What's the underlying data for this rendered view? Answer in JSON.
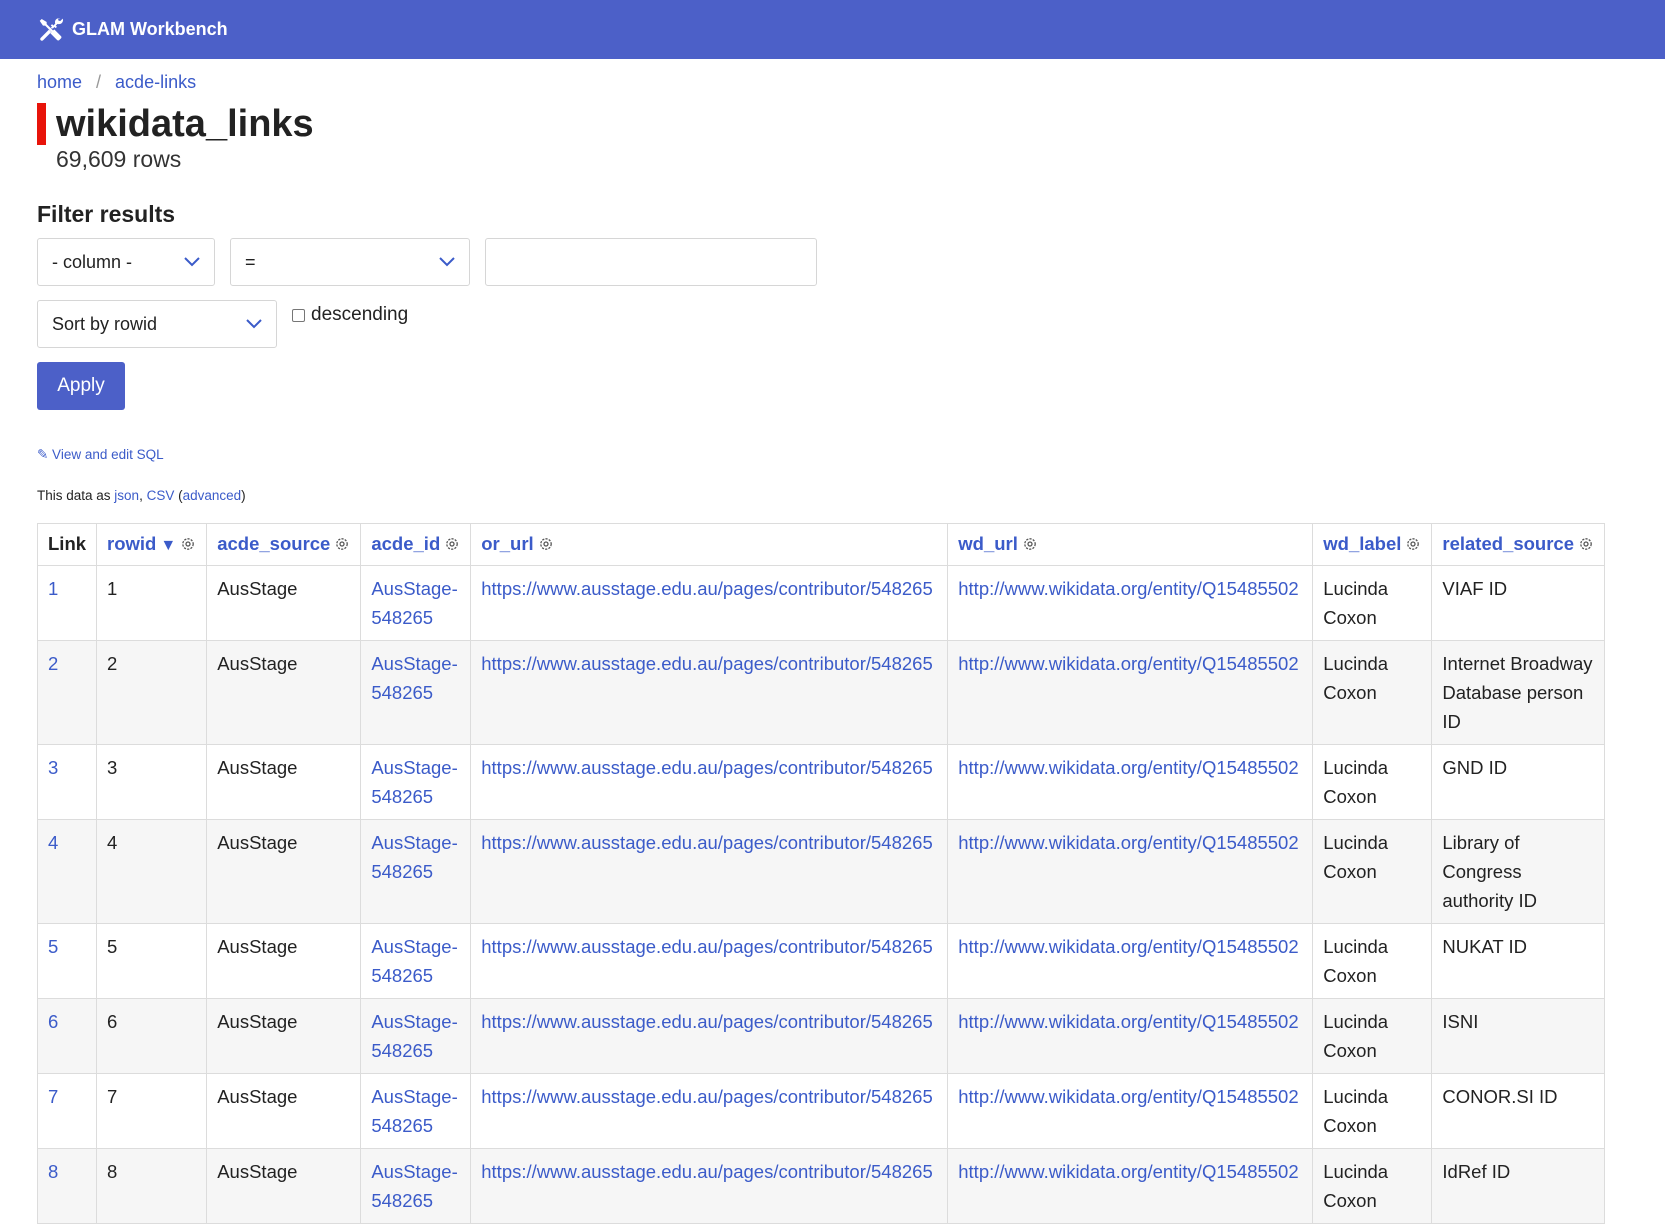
{
  "header": {
    "app_title": "GLAM Workbench",
    "icon": "tools-icon"
  },
  "breadcrumb": {
    "home": "home",
    "separator": "/",
    "db": "acde-links"
  },
  "page": {
    "title": "wikidata_links",
    "row_count": "69,609 rows"
  },
  "filter": {
    "heading": "Filter results",
    "column_select": "- column -",
    "op_select": "=",
    "value": "",
    "sort_select": "Sort by rowid",
    "descending_label": "descending",
    "descending_checked": false,
    "apply_label": "Apply"
  },
  "links": {
    "view_sql": "✎ View and edit SQL",
    "data_as_prefix": "This data as ",
    "json": "json",
    "comma": ", ",
    "csv": "CSV",
    "paren_open": " (",
    "advanced": "advanced",
    "paren_close": ")"
  },
  "table": {
    "columns": [
      "Link",
      "rowid",
      "acde_source",
      "acde_id",
      "or_url",
      "wd_url",
      "wd_label",
      "related_source"
    ],
    "sort_indicator": "▼",
    "rows": [
      {
        "link": "1",
        "rowid": "1",
        "acde_source": "AusStage",
        "acde_id": "AusStage-548265",
        "or_url": "https://www.ausstage.edu.au/pages/contributor/548265",
        "wd_url": "http://www.wikidata.org/entity/Q15485502",
        "wd_label": "Lucinda Coxon",
        "related_source": "VIAF ID"
      },
      {
        "link": "2",
        "rowid": "2",
        "acde_source": "AusStage",
        "acde_id": "AusStage-548265",
        "or_url": "https://www.ausstage.edu.au/pages/contributor/548265",
        "wd_url": "http://www.wikidata.org/entity/Q15485502",
        "wd_label": "Lucinda Coxon",
        "related_source": "Internet Broadway Database person ID"
      },
      {
        "link": "3",
        "rowid": "3",
        "acde_source": "AusStage",
        "acde_id": "AusStage-548265",
        "or_url": "https://www.ausstage.edu.au/pages/contributor/548265",
        "wd_url": "http://www.wikidata.org/entity/Q15485502",
        "wd_label": "Lucinda Coxon",
        "related_source": "GND ID"
      },
      {
        "link": "4",
        "rowid": "4",
        "acde_source": "AusStage",
        "acde_id": "AusStage-548265",
        "or_url": "https://www.ausstage.edu.au/pages/contributor/548265",
        "wd_url": "http://www.wikidata.org/entity/Q15485502",
        "wd_label": "Lucinda Coxon",
        "related_source": "Library of Congress authority ID"
      },
      {
        "link": "5",
        "rowid": "5",
        "acde_source": "AusStage",
        "acde_id": "AusStage-548265",
        "or_url": "https://www.ausstage.edu.au/pages/contributor/548265",
        "wd_url": "http://www.wikidata.org/entity/Q15485502",
        "wd_label": "Lucinda Coxon",
        "related_source": "NUKAT ID"
      },
      {
        "link": "6",
        "rowid": "6",
        "acde_source": "AusStage",
        "acde_id": "AusStage-548265",
        "or_url": "https://www.ausstage.edu.au/pages/contributor/548265",
        "wd_url": "http://www.wikidata.org/entity/Q15485502",
        "wd_label": "Lucinda Coxon",
        "related_source": "ISNI"
      },
      {
        "link": "7",
        "rowid": "7",
        "acde_source": "AusStage",
        "acde_id": "AusStage-548265",
        "or_url": "https://www.ausstage.edu.au/pages/contributor/548265",
        "wd_url": "http://www.wikidata.org/entity/Q15485502",
        "wd_label": "Lucinda Coxon",
        "related_source": "CONOR.SI ID"
      },
      {
        "link": "8",
        "rowid": "8",
        "acde_source": "AusStage",
        "acde_id": "AusStage-548265",
        "or_url": "https://www.ausstage.edu.au/pages/contributor/548265",
        "wd_url": "http://www.wikidata.org/entity/Q15485502",
        "wd_label": "Lucinda Coxon",
        "related_source": "IdRef ID"
      }
    ]
  },
  "colors": {
    "accent": "#4c60c8",
    "link": "#3b5bc9",
    "title_bar": "#e8140a"
  }
}
